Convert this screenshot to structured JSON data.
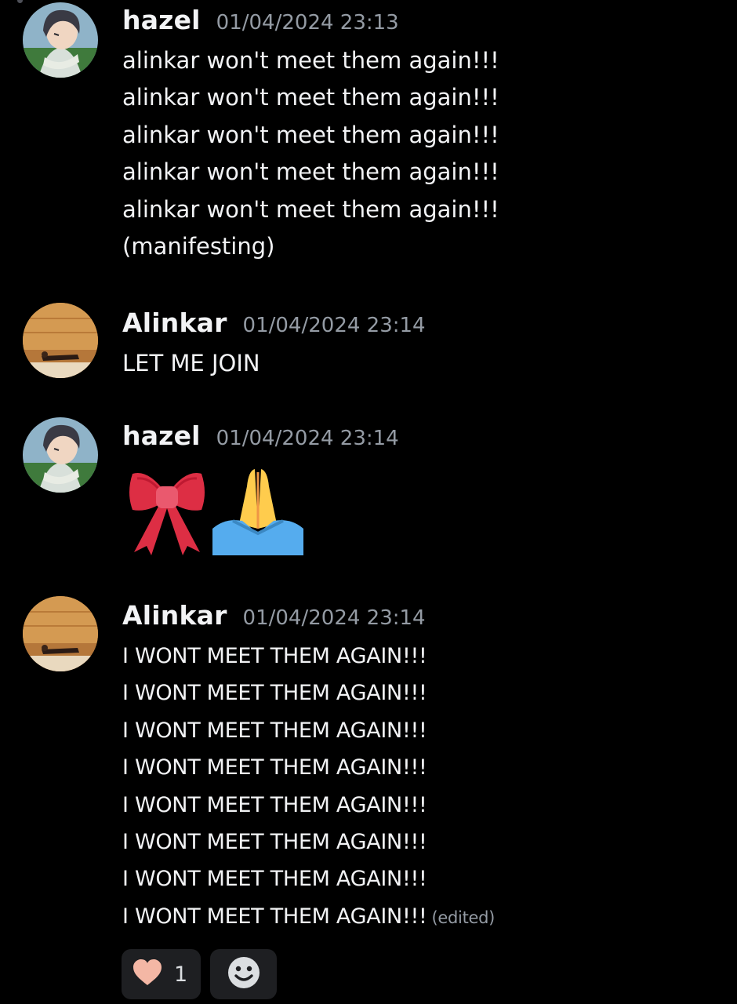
{
  "messages": [
    {
      "author": "hazel",
      "timestamp": "01/04/2024 23:13",
      "lines": [
        "alinkar won't meet them again!!!",
        "alinkar won't meet them again!!!",
        "alinkar won't meet them again!!!",
        "alinkar won't meet them again!!!",
        "alinkar won't meet them again!!!",
        "(manifesting)"
      ]
    },
    {
      "author": "Alinkar",
      "timestamp": "01/04/2024 23:14",
      "lines": [
        "LET ME JOIN"
      ]
    },
    {
      "author": "hazel",
      "timestamp": "01/04/2024 23:14",
      "emojis": [
        "ribbon-emoji",
        "folded-hands-emoji"
      ]
    },
    {
      "author": "Alinkar",
      "timestamp": "01/04/2024 23:14",
      "lines": [
        "I WONT MEET THEM AGAIN!!!",
        "I WONT MEET THEM AGAIN!!!",
        "I WONT MEET THEM AGAIN!!!",
        "I WONT MEET THEM AGAIN!!!",
        "I WONT MEET THEM AGAIN!!!",
        "I WONT MEET THEM AGAIN!!!",
        "I WONT MEET THEM AGAIN!!!",
        "I WONT MEET THEM AGAIN!!!"
      ],
      "edited_label": "(edited)",
      "reactions": [
        {
          "icon": "heart-icon",
          "count": "1"
        }
      ],
      "add_reaction_icon": "smiley-icon"
    }
  ],
  "colors": {
    "background": "#000000",
    "text": "#f2f3f5",
    "muted": "#949ba4",
    "reaction_bg": "#1e1f22",
    "heart": "#f4b7a5"
  }
}
